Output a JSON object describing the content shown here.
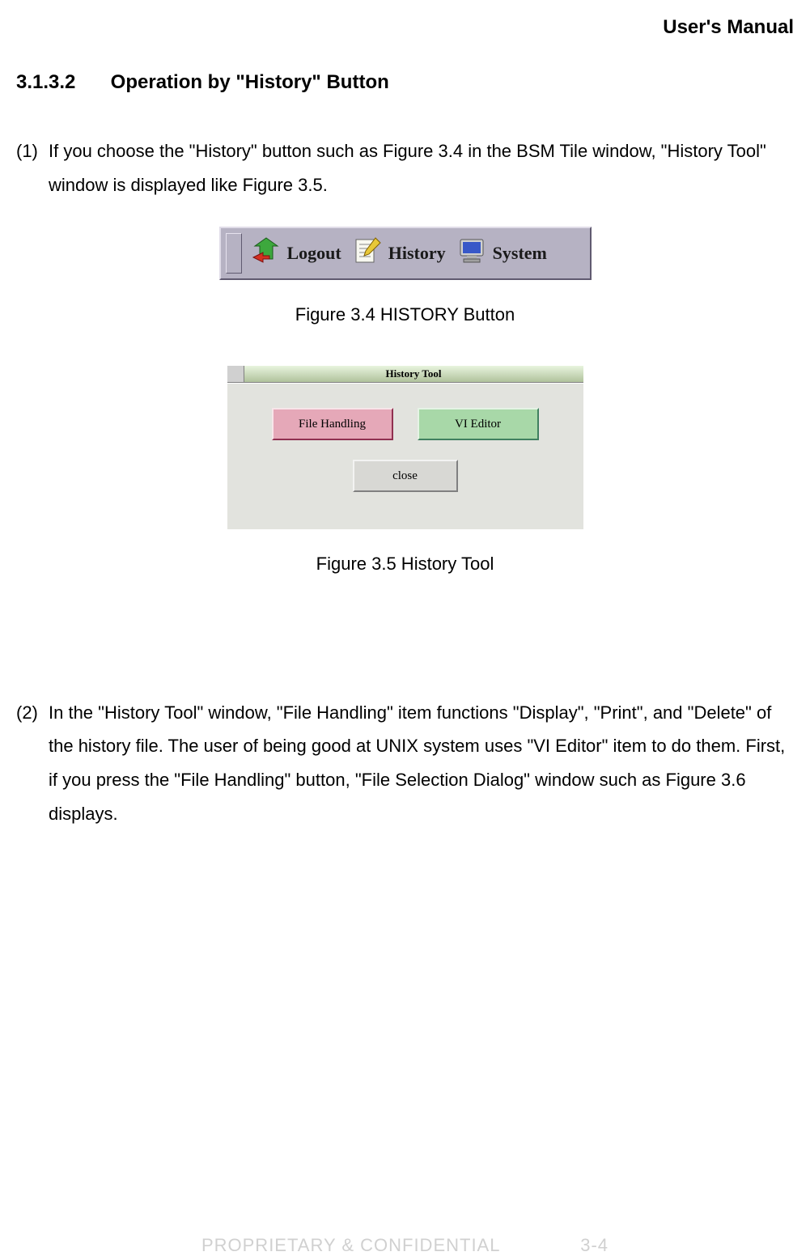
{
  "header": {
    "title": "User's Manual"
  },
  "section": {
    "number": "3.1.3.2",
    "title": "Operation by \"History\" Button"
  },
  "items": [
    {
      "marker": "(1)",
      "text": "If you choose the \"History\" button such as Figure 3.4 in the BSM Tile window, \"History Tool\" window is displayed like Figure 3.5."
    },
    {
      "marker": "(2)",
      "text": "In the \"History Tool\" window, \"File Handling\" item functions \"Display\", \"Print\", and \"Delete\" of the history file. The user of being good at UNIX system uses \"VI Editor\" item to do them. First, if you press the \"File Handling\" button, \"File Selection Dialog\" window such as Figure 3.6 displays."
    }
  ],
  "figure34": {
    "caption": "Figure 3.4 HISTORY Button",
    "toolbar": {
      "logout": "Logout",
      "history": "History",
      "system": "System"
    }
  },
  "figure35": {
    "caption": "Figure 3.5 History Tool",
    "window": {
      "title": "History Tool",
      "file_handling": "File Handling",
      "vi_editor": "VI Editor",
      "close": "close"
    }
  },
  "footer": {
    "left": "PROPRIETARY & CONFIDENTIAL",
    "right": "3-4"
  }
}
